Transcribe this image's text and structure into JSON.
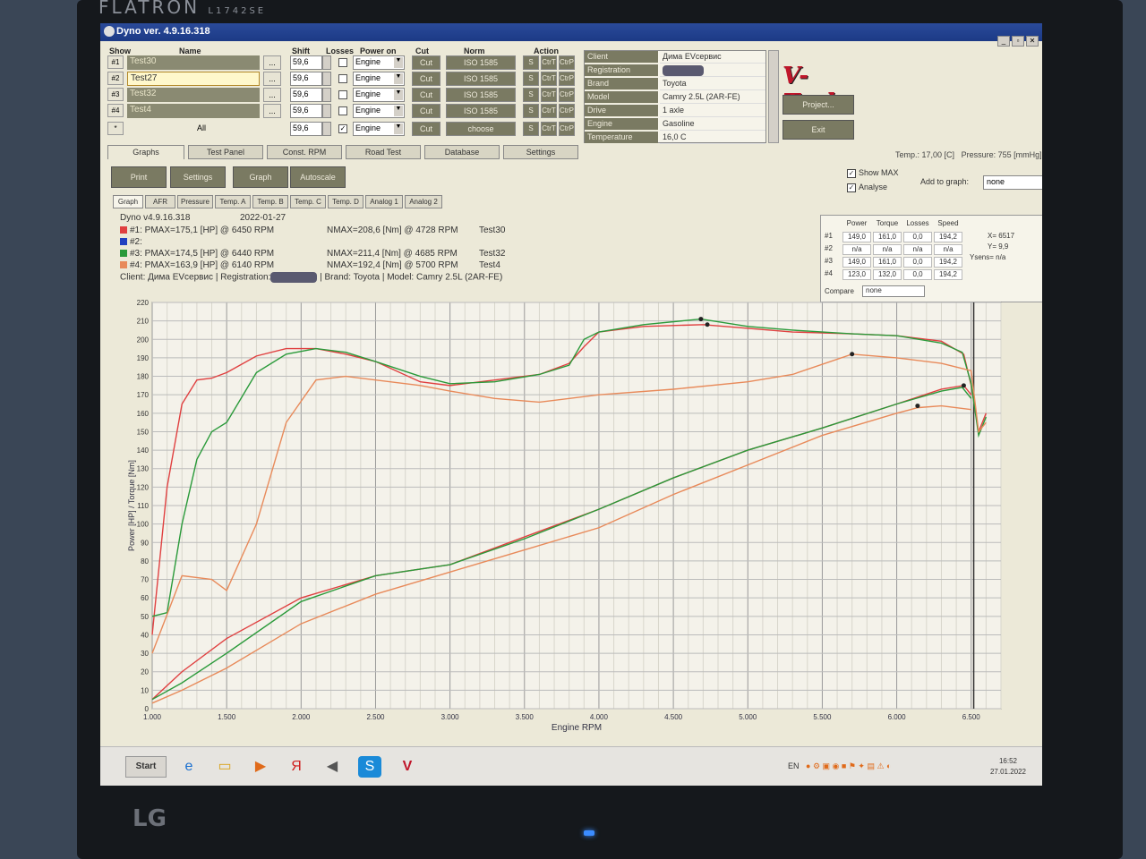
{
  "monitor": {
    "brand_top": "FLATRON",
    "model_top": "L1742SE",
    "brand_bottom": "LG"
  },
  "window": {
    "title": "Dyno ver. 4.9.16.318"
  },
  "grid_headers": {
    "show": "Show",
    "name": "Name",
    "shift": "Shift",
    "losses": "Losses",
    "power_on": "Power on",
    "cut": "Cut",
    "norm": "Norm",
    "action": "Action"
  },
  "tests": [
    {
      "num": "#1",
      "name": "Test30",
      "shift": "59,6",
      "losses": false,
      "power_on": "Engine",
      "cut": "Cut",
      "norm": "ISO 1585"
    },
    {
      "num": "#2",
      "name": "Test27",
      "shift": "59,6",
      "losses": false,
      "power_on": "Engine",
      "cut": "Cut",
      "norm": "ISO 1585"
    },
    {
      "num": "#3",
      "name": "Test32",
      "shift": "59,6",
      "losses": false,
      "power_on": "Engine",
      "cut": "Cut",
      "norm": "ISO 1585"
    },
    {
      "num": "#4",
      "name": "Test4",
      "shift": "59,6",
      "losses": false,
      "power_on": "Engine",
      "cut": "Cut",
      "norm": "ISO 1585"
    }
  ],
  "all_row": {
    "num": "*",
    "name": "All",
    "shift": "59,6",
    "power_on": "Engine",
    "cut": "Cut",
    "norm": "choose"
  },
  "action_labels": {
    "s": "S",
    "ctrl_t": "CtrT",
    "ctrl_p": "CtrP"
  },
  "client": [
    {
      "key": "Client",
      "value": "Дима EVсервис"
    },
    {
      "key": "Registration",
      "value": ""
    },
    {
      "key": "Brand",
      "value": "Toyota"
    },
    {
      "key": "Model",
      "value": "Camry 2.5L (2AR-FE)"
    },
    {
      "key": "Drive",
      "value": "1 axle"
    },
    {
      "key": "Engine",
      "value": "Gasoline"
    },
    {
      "key": "Temperature",
      "value": "16,0 C"
    }
  ],
  "side_buttons": {
    "logo": "V-Tech",
    "project": "Project...",
    "exit": "Exit"
  },
  "tabs": [
    "Graphs",
    "Test Panel",
    "Const. RPM",
    "Road Test",
    "Database",
    "Settings"
  ],
  "status": {
    "temp": "Temp.: 17,00 [C]",
    "pressure": "Pressure: 755 [mmHg]"
  },
  "toolbar": {
    "print": "Print",
    "settings": "Settings",
    "graph": "Graph",
    "autoscale": "Autoscale"
  },
  "options": {
    "show_max": "Show MAX",
    "analyse": "Analyse",
    "add_to_graph": "Add to graph:",
    "add_value": "none"
  },
  "subtabs": [
    "Graph",
    "AFR",
    "Pressure",
    "Temp. A",
    "Temp. B",
    "Temp. C",
    "Temp. D",
    "Analog 1",
    "Analog 2"
  ],
  "header": {
    "version": "Dyno v4.9.16.318",
    "date": "2022-01-27",
    "lines": [
      {
        "text": "#1: PMAX=175,1 [HP] @ 6450 RPM",
        "nmax": "NMAX=208,6 [Nm] @ 4728 RPM",
        "test": "Test30",
        "color": "#e04040"
      },
      {
        "text": "#2:",
        "nmax": "",
        "test": "",
        "color": "#2040c0"
      },
      {
        "text": "#3: PMAX=174,5 [HP] @ 6440 RPM",
        "nmax": "NMAX=211,4 [Nm] @ 4685 RPM",
        "test": "Test32",
        "color": "#2a9a3a"
      },
      {
        "text": "#4: PMAX=163,9 [HP] @ 6140 RPM",
        "nmax": "NMAX=192,4 [Nm] @ 5700 RPM",
        "test": "Test4",
        "color": "#e88a5a"
      }
    ],
    "client_line": "Client: Дима EVсервис | Registration:",
    "brand_line": "| Brand: Toyota | Model: Camry 2.5L (2AR-FE)"
  },
  "stats": {
    "headers": [
      "Power",
      "Torque",
      "Losses",
      "Speed"
    ],
    "rows": [
      {
        "num": "#1",
        "values": [
          "149,0",
          "161,0",
          "0,0",
          "194,2"
        ]
      },
      {
        "num": "#2",
        "values": [
          "n/a",
          "n/a",
          "n/a",
          "n/a"
        ]
      },
      {
        "num": "#3",
        "values": [
          "149,0",
          "161,0",
          "0,0",
          "194,2"
        ]
      },
      {
        "num": "#4",
        "values": [
          "123,0",
          "132,0",
          "0,0",
          "194,2"
        ]
      }
    ],
    "x_label": "X=",
    "x_value": "6517",
    "y_label": "Y=",
    "y_value": "9,9",
    "ysens_label": "Ysens=",
    "ysens_value": "n/a",
    "compare_label": "Compare",
    "compare_value": "none"
  },
  "chart_data": {
    "type": "line",
    "xlabel": "Engine RPM",
    "ylabel": "Power [HP] / Torque [Nm]",
    "xlim": [
      1000,
      6700
    ],
    "ylim": [
      0,
      220
    ],
    "x_ticks": [
      1000,
      1500,
      2000,
      2500,
      3000,
      3500,
      4000,
      4500,
      5000,
      5500,
      6000,
      6500
    ],
    "x_tick_labels": [
      "1.000",
      "1.500",
      "2.000",
      "2.500",
      "3.000",
      "3.500",
      "4.000",
      "4.500",
      "5.000",
      "5.500",
      "6.000",
      "6.500"
    ],
    "y_ticks": [
      0,
      10,
      20,
      30,
      40,
      50,
      60,
      70,
      80,
      90,
      100,
      110,
      120,
      130,
      140,
      150,
      160,
      170,
      180,
      190,
      200,
      210,
      220
    ],
    "grid": true,
    "series": [
      {
        "name": "Test30 Torque",
        "color": "#e04040",
        "x": [
          1000,
          1100,
          1200,
          1300,
          1400,
          1500,
          1700,
          1900,
          2100,
          2300,
          2500,
          2800,
          3000,
          3300,
          3600,
          3800,
          3900,
          4000,
          4300,
          4700,
          5000,
          5300,
          5700,
          6000,
          6300,
          6450,
          6500,
          6550,
          6600
        ],
        "y": [
          40,
          120,
          165,
          178,
          179,
          182,
          191,
          195,
          195,
          192,
          188,
          177,
          175,
          178,
          181,
          187,
          196,
          204,
          207,
          208,
          206,
          204,
          203,
          202,
          199,
          192,
          175,
          150,
          160
        ]
      },
      {
        "name": "Test30 Power",
        "color": "#e04040",
        "x": [
          1000,
          1200,
          1500,
          2000,
          2500,
          3000,
          3500,
          4000,
          4500,
          5000,
          5500,
          6000,
          6300,
          6450,
          6500
        ],
        "y": [
          5,
          20,
          38,
          60,
          72,
          78,
          93,
          108,
          125,
          140,
          152,
          165,
          173,
          175,
          170
        ]
      },
      {
        "name": "Test32 Torque",
        "color": "#2a9a3a",
        "x": [
          1000,
          1100,
          1200,
          1300,
          1400,
          1500,
          1700,
          1900,
          2100,
          2300,
          2500,
          2800,
          3000,
          3300,
          3600,
          3800,
          3900,
          4000,
          4300,
          4685,
          5000,
          5300,
          5700,
          6000,
          6300,
          6440,
          6500,
          6550,
          6600
        ],
        "y": [
          50,
          52,
          100,
          135,
          150,
          155,
          182,
          192,
          195,
          193,
          188,
          180,
          176,
          177,
          181,
          186,
          200,
          204,
          208,
          211,
          207,
          205,
          203,
          202,
          198,
          193,
          176,
          148,
          158
        ]
      },
      {
        "name": "Test32 Power",
        "color": "#2a9a3a",
        "x": [
          1000,
          1200,
          1500,
          2000,
          2500,
          3000,
          3500,
          4000,
          4500,
          5000,
          5500,
          6000,
          6300,
          6440,
          6500
        ],
        "y": [
          5,
          14,
          30,
          58,
          72,
          78,
          92,
          108,
          125,
          140,
          152,
          165,
          172,
          174,
          168
        ]
      },
      {
        "name": "Test4 Torque",
        "color": "#e88a5a",
        "x": [
          1000,
          1200,
          1400,
          1500,
          1700,
          1900,
          2100,
          2300,
          2500,
          2800,
          3000,
          3300,
          3600,
          4000,
          4500,
          5000,
          5300,
          5700,
          6000,
          6300,
          6500,
          6550,
          6600
        ],
        "y": [
          30,
          72,
          70,
          64,
          100,
          155,
          178,
          180,
          178,
          175,
          172,
          168,
          166,
          170,
          173,
          177,
          181,
          192,
          190,
          187,
          183,
          150,
          155
        ]
      },
      {
        "name": "Test4 Power",
        "color": "#e88a5a",
        "x": [
          1000,
          1200,
          1500,
          2000,
          2500,
          3000,
          3500,
          4000,
          4500,
          5000,
          5500,
          6000,
          6140,
          6300,
          6500
        ],
        "y": [
          3,
          10,
          22,
          46,
          62,
          74,
          86,
          98,
          116,
          132,
          148,
          160,
          163,
          164,
          162
        ]
      }
    ],
    "markers": [
      {
        "x": 4685,
        "y": 211,
        "color": "#222"
      },
      {
        "x": 4728,
        "y": 208,
        "color": "#222"
      },
      {
        "x": 5700,
        "y": 192,
        "color": "#222"
      },
      {
        "x": 6450,
        "y": 175,
        "color": "#222"
      },
      {
        "x": 6140,
        "y": 164,
        "color": "#222"
      }
    ],
    "cursor_x": 6517
  },
  "taskbar": {
    "start": "Start",
    "lang": "EN",
    "time": "16:52",
    "date": "27.01.2022"
  }
}
